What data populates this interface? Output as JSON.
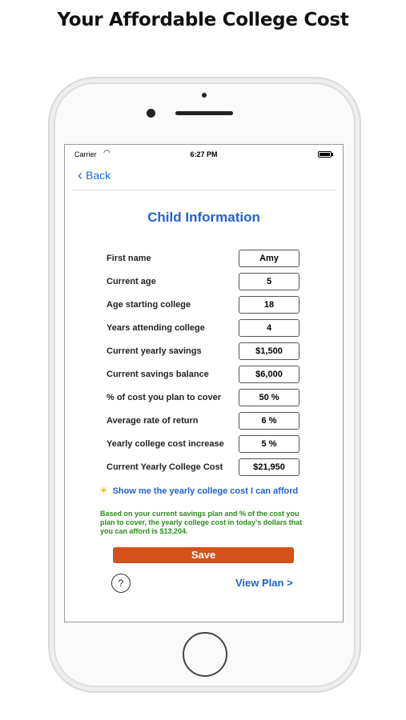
{
  "headline": "Your Affordable College Cost",
  "status_bar": {
    "carrier": "Carrier",
    "time": "6:27 PM"
  },
  "nav": {
    "back_label": "Back"
  },
  "screen_title": "Child Information",
  "fields": [
    {
      "label": "First name",
      "value": "Amy"
    },
    {
      "label": "Current age",
      "value": "5"
    },
    {
      "label": "Age starting college",
      "value": "18"
    },
    {
      "label": "Years attending college",
      "value": "4"
    },
    {
      "label": "Current yearly savings",
      "value": "$1,500"
    },
    {
      "label": "Current savings balance",
      "value": "$6,000"
    },
    {
      "label": "% of cost you plan to cover",
      "value": "50 %"
    },
    {
      "label": "Average rate of return",
      "value": "6 %"
    },
    {
      "label": "Yearly college cost increase",
      "value": "5 %"
    },
    {
      "label": "Current Yearly College Cost",
      "value": "$21,950"
    }
  ],
  "afford_link": "Show me the yearly college cost I can afford",
  "result_text": "Based on your current savings plan and % of the cost you plan to cover, the yearly college cost in today's dollars that you can afford is $13,204.",
  "save_label": "Save",
  "help_label": "?",
  "view_plan_label": "View Plan >",
  "colors": {
    "accent_blue": "#2063d0",
    "save_orange": "#d5501a",
    "result_green": "#2c8a1e"
  },
  "icons": {
    "back": "chevron-left-icon",
    "afford": "lightbulb-icon",
    "status": [
      "wifi-icon",
      "battery-icon"
    ]
  }
}
